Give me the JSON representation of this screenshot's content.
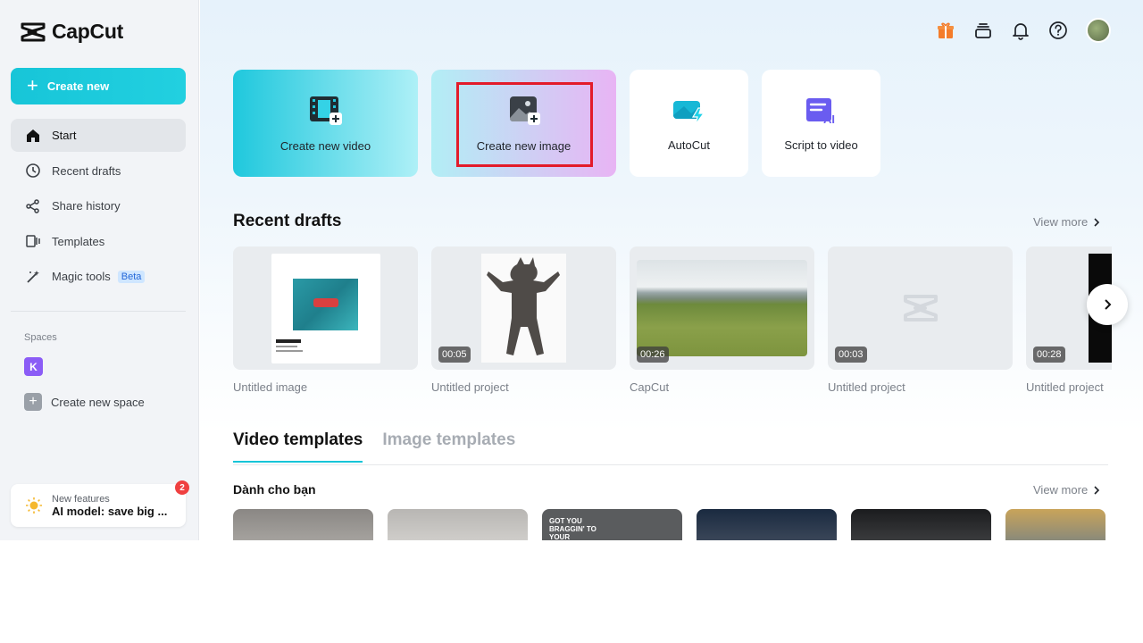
{
  "app": {
    "name": "CapCut"
  },
  "sidebar": {
    "create_label": "Create new",
    "items": [
      {
        "label": "Start",
        "icon": "home-icon",
        "active": true
      },
      {
        "label": "Recent drafts",
        "icon": "clock-icon"
      },
      {
        "label": "Share history",
        "icon": "share-icon"
      },
      {
        "label": "Templates",
        "icon": "templates-icon"
      },
      {
        "label": "Magic tools",
        "icon": "magic-wand-icon",
        "badge": "Beta"
      }
    ],
    "spaces_label": "Spaces",
    "space_initial": "K",
    "create_space_label": "Create new space",
    "features": {
      "label": "New features",
      "title": "AI model: save big ...",
      "count": "2"
    }
  },
  "header_icons": [
    "gift-icon",
    "layers-icon",
    "bell-icon",
    "help-icon",
    "avatar"
  ],
  "actions": [
    {
      "label": "Create new video",
      "icon": "film-plus-icon"
    },
    {
      "label": "Create new image",
      "icon": "image-plus-icon"
    },
    {
      "label": "AutoCut",
      "icon": "autocut-icon"
    },
    {
      "label": "Script to video",
      "icon": "script-ai-icon"
    }
  ],
  "recent": {
    "title": "Recent drafts",
    "view_more": "View more",
    "items": [
      {
        "name": "Untitled image",
        "duration": ""
      },
      {
        "name": "Untitled project",
        "duration": "00:05"
      },
      {
        "name": "CapCut",
        "duration": "00:26"
      },
      {
        "name": "Untitled project",
        "duration": "00:03"
      },
      {
        "name": "Untitled project",
        "duration": "00:28"
      }
    ]
  },
  "templates": {
    "tabs": [
      "Video templates",
      "Image templates"
    ],
    "section_title": "Dành cho bạn",
    "view_more": "View more",
    "thumb3_text": "GOT YOU BRAGGIN' TO YOUR"
  },
  "colors": {
    "accent": "#17c5d8",
    "highlight": "#e31b2a"
  }
}
